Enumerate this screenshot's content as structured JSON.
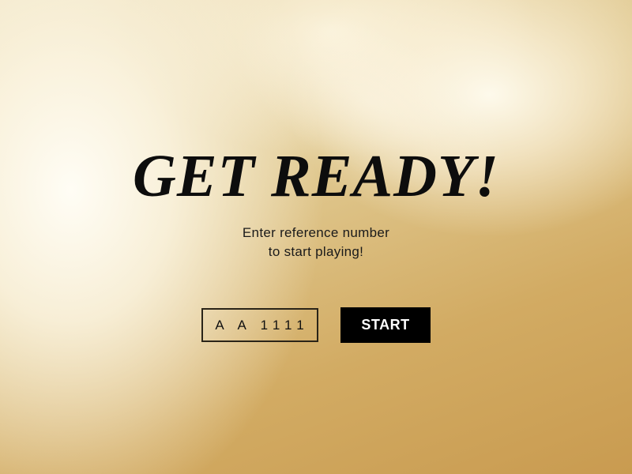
{
  "title": "GET READY!",
  "subtitle": {
    "line1": "Enter reference number",
    "line2": "to start playing!"
  },
  "reference_input": {
    "value": "A A 1111"
  },
  "start_button": {
    "label": "START"
  },
  "colors": {
    "button_bg": "#000000",
    "button_text": "#ffffff",
    "text": "#0d0d0d",
    "background_gold": "#d2ab63"
  }
}
